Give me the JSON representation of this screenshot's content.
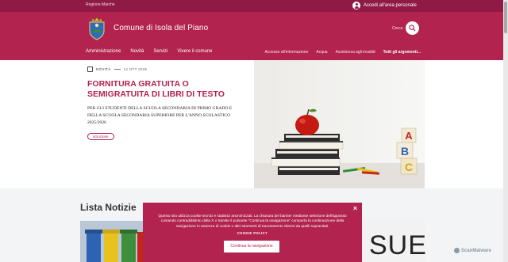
{
  "topbar": {
    "region_link": "Regione Marche",
    "login_label": "Accedi all'area personale"
  },
  "header": {
    "site_name": "Comune di Isola del Piano",
    "search_label": "Cerca"
  },
  "main_nav": [
    "Amministrazione",
    "Novità",
    "Servizi",
    "Vivere il comune"
  ],
  "secondary_nav": [
    "Accesso all'informazione",
    "Acqua",
    "Assistenza agli invalidi",
    "Tutti gli argomenti..."
  ],
  "hero": {
    "category": "NOVITÀ",
    "date": "14 OTT 2025",
    "title": "FORNITURA GRATUITA O SEMIGRATUITA DI LIBRI DI TESTO",
    "subtitle": "PER GLI STUDENTI DELLA SCUOLA SECONDARIA DI PRIMO GRADO E DELLA SCUOLA SECONDARIA SUPERIORE PER L'ANNO SCOLASTICO 2025/2026",
    "tag": "Istruzione",
    "image_blocks": [
      "A",
      "B",
      "C"
    ]
  },
  "lista": {
    "title": "Lista Notizie",
    "right_thumb_text": "SUE"
  },
  "cookie": {
    "text": "Questo sito utilizza cookie tecnici e statistici anonimizzati. La chiusura del banner mediante selezione dell'apposito comando contraddistinto dalla X o tramite il pulsante \"Continua la navigazione\" comporta la continuazione della navigazione in assenza di cookie o altri strumenti di tracciamento diversi da quelli sopracitati.",
    "policy_link": "COOKIE POLICY",
    "button_label": "Continua la navigazione",
    "close_symbol": "×"
  },
  "watermark": "ScanMalware",
  "colors": {
    "brand": "#b2234f",
    "brand_dark": "#8f1a45",
    "section_bg": "#f3f4f6"
  }
}
